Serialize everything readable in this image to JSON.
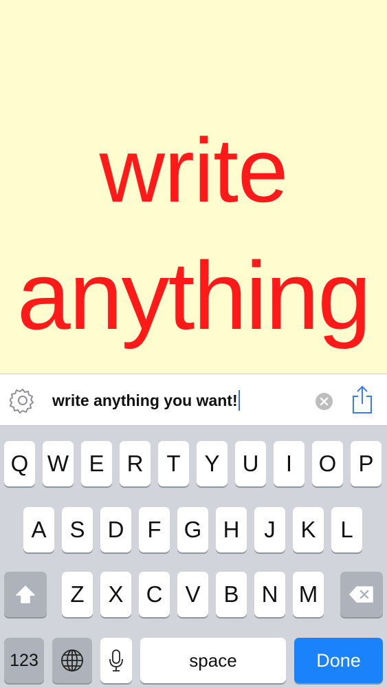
{
  "canvas": {
    "line1": "write",
    "line2": "anything",
    "background_color": "#fffdd0",
    "text_color": "#ff1a1a"
  },
  "input_bar": {
    "settings_icon": "gear-icon",
    "text_value": "write anything you want!",
    "clear_icon": "clear-circle-icon",
    "share_icon": "share-icon"
  },
  "keyboard": {
    "row1": [
      "Q",
      "W",
      "E",
      "R",
      "T",
      "Y",
      "U",
      "I",
      "O",
      "P"
    ],
    "row2": [
      "A",
      "S",
      "D",
      "F",
      "G",
      "H",
      "J",
      "K",
      "L"
    ],
    "row3": [
      "Z",
      "X",
      "C",
      "V",
      "B",
      "N",
      "M"
    ],
    "shift_icon": "shift-arrow-icon",
    "delete_icon": "backspace-icon",
    "numbers_label": "123",
    "globe_icon": "globe-icon",
    "mic_icon": "microphone-icon",
    "space_label": "space",
    "done_label": "Done",
    "done_color": "#1a82fb"
  }
}
